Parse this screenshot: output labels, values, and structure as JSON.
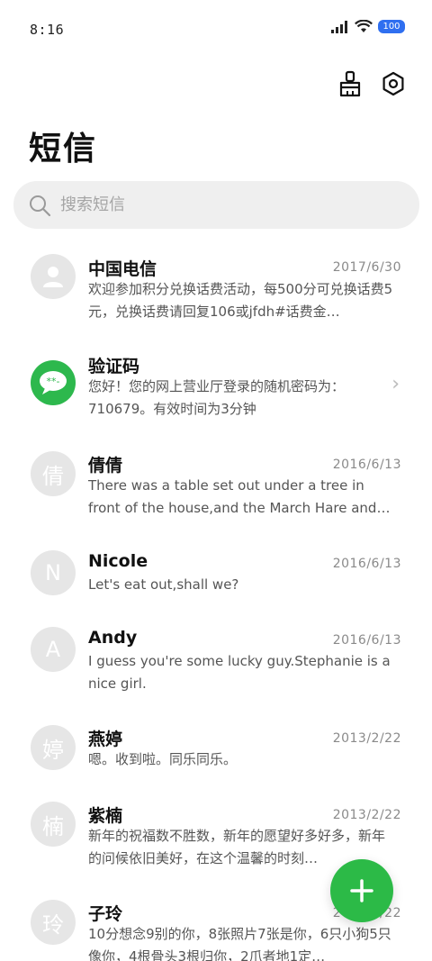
{
  "status_bar": {
    "time": "8:16",
    "battery": "100"
  },
  "header": {
    "title": "短信"
  },
  "search": {
    "placeholder": "搜索短信"
  },
  "messages": [
    {
      "avatar": "",
      "avatar_type": "person",
      "name": "中国电信",
      "date": "2017/6/30",
      "preview": "欢迎参加积分兑换话费活动，每500分可兑换话费5元，兑换话费请回复106或jfdh#话费金…"
    },
    {
      "avatar": "",
      "avatar_type": "chat",
      "name": "验证码",
      "date": "",
      "preview": "您好！您的网上营业厅登录的随机密码为：710679。有效时间为3分钟"
    },
    {
      "avatar": "倩",
      "avatar_type": "letter",
      "name": "倩倩",
      "date": "2016/6/13",
      "preview": "There was a table set out under a tree in front of the house,and the March Hare and the Hatte…"
    },
    {
      "avatar": "N",
      "avatar_type": "letter",
      "name": "Nicole",
      "date": "2016/6/13",
      "preview": "Let's eat out,shall we?"
    },
    {
      "avatar": "A",
      "avatar_type": "letter",
      "name": "Andy",
      "date": "2016/6/13",
      "preview": "I guess you're some lucky guy.Stephanie is a nice girl."
    },
    {
      "avatar": "婷",
      "avatar_type": "letter",
      "name": "燕婷",
      "date": "2013/2/22",
      "preview": "嗯。收到啦。同乐同乐。"
    },
    {
      "avatar": "楠",
      "avatar_type": "letter",
      "name": "紫楠",
      "date": "2013/2/22",
      "preview": "新年的祝福数不胜数，新年的愿望好多好多，新年的问候依旧美好，在这个温馨的时刻…"
    },
    {
      "avatar": "玲",
      "avatar_type": "letter",
      "name": "子玲",
      "date": "2013/2/22",
      "preview": "10分想念9别的你，8张照片7张是你，6只小狗5只像你，4根骨头3根归你，2爪者地1定…"
    }
  ],
  "fab": {
    "label": "+"
  },
  "colors": {
    "accent": "#2cba47",
    "battery": "#2f6ff0"
  }
}
